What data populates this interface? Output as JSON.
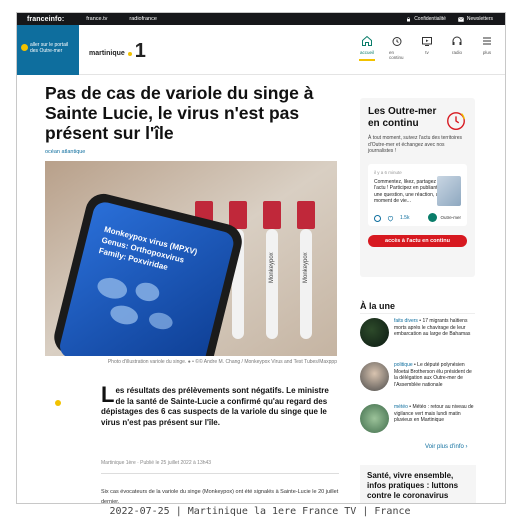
{
  "topbar": {
    "brand": "franceinfo:",
    "links": [
      "france.tv",
      "radiofrance"
    ],
    "right": [
      "Confidentialité",
      "Newsletters"
    ]
  },
  "header": {
    "portal_label": "aller sur le portail des Outre-mer",
    "channel_name": "martinique",
    "channel_number": "1",
    "nav": [
      {
        "label": "accueil",
        "icon": "home-icon",
        "active": true
      },
      {
        "label": "en continu",
        "icon": "clock-icon",
        "active": false
      },
      {
        "label": "tv",
        "icon": "tv-icon",
        "active": false
      },
      {
        "label": "radio",
        "icon": "headphones-icon",
        "active": false
      },
      {
        "label": "plus",
        "icon": "menu-icon",
        "active": false
      }
    ]
  },
  "article": {
    "title": "Pas de cas de variole du singe à Sainte Lucie, le virus n'est pas présent sur l'île",
    "kicker": "océan atlantique",
    "photo": {
      "screen_lines": [
        "Monkeypox virus (MPXV)",
        "Genus: Orthopoxvirus",
        "Family: Poxviridae"
      ],
      "tube_label": "Monkeypox"
    },
    "caption": "Photo d'illustration variole du singe. ● • ©© Andre M. Chang / Monkeypox Virus and Test Tubes/Maxppp",
    "lead_dropcap": "L",
    "lead": "es résultats des prélèvements sont négatifs. Le ministre de la santé de Sainte-Lucie a confirmé qu'au regard des dépistages des 6 cas suspects de la variole du singe que le virus n'est pas présent sur l'île.",
    "byline": "Martinique 1ère · Publié le 25 juillet 2022 à 13h43",
    "body": "Six cas évocateurs de la variole du singe (Monkeypox) ont été signalés à Sainte-Lucie le 20 juillet dernier."
  },
  "sidebar": {
    "outremer": {
      "title": "Les Outre-mer en continu",
      "description": "À tout moment, suivez l'actu des territoires d'Outre-mer et échangez avec nos journalistes !",
      "card": {
        "time": "il y a 6 minute",
        "message": "Commentez, likez, partagez l'actu ! Participez en publiant une question, une réaction, un moment de vie...",
        "likes": "1.5k",
        "author": "Outre-mer"
      },
      "button": "accès à l'actu en continu"
    },
    "alaune": {
      "title": "À la une",
      "items": [
        {
          "category": "faits divers",
          "text": "17 migrants haïtiens morts après le chavirage de leur embarcation au large de Bahamas"
        },
        {
          "category": "politique",
          "text": "Le député polynésien Moetai Brotherson élu président de la délégation aux Outre-mer de l'Assemblée nationale"
        },
        {
          "category": "météo",
          "text": "Météo : retour au niveau de vigilance vert mais lundi matin pluvieux en Martinique"
        }
      ],
      "more": "Voir plus d'info"
    },
    "promo": "Santé, vivre ensemble, infos pratiques : luttons contre le coronavirus"
  },
  "footer": "2022-07-25 | Martinique la 1ere France TV | France",
  "colors": {
    "accent_yellow": "#f2c200",
    "brand_blue": "#0e6e9e",
    "live_red": "#d71920",
    "dark": "#16171a"
  }
}
